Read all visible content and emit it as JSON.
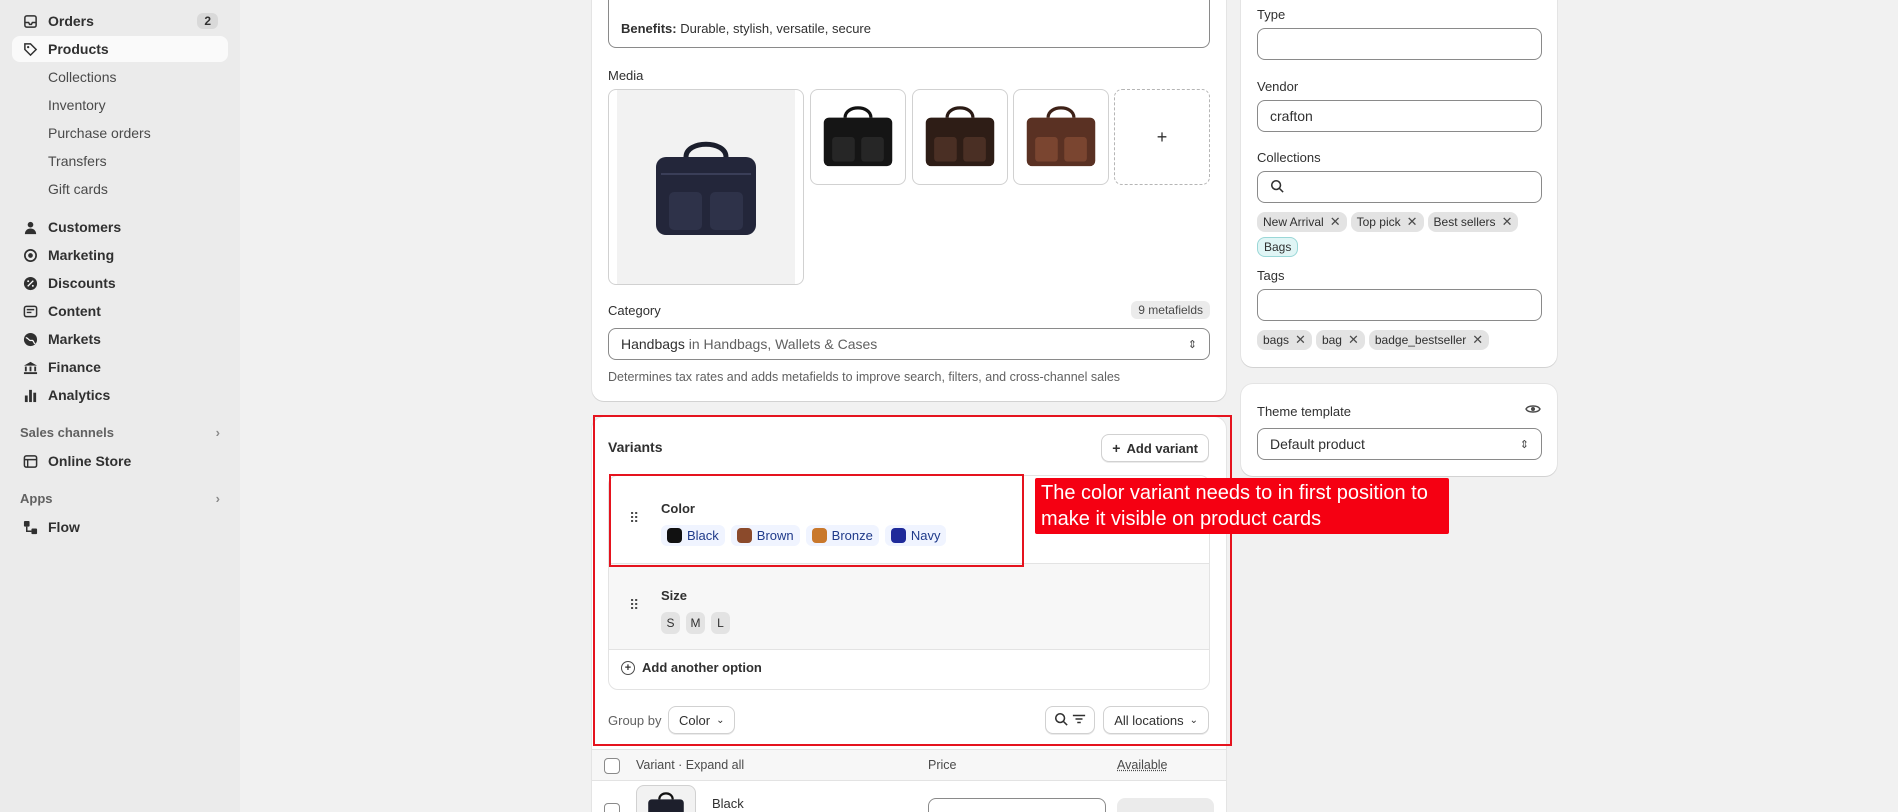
{
  "sidebar": {
    "orders": {
      "label": "Orders",
      "count": "2"
    },
    "products": {
      "label": "Products"
    },
    "products_sub": [
      "Collections",
      "Inventory",
      "Purchase orders",
      "Transfers",
      "Gift cards"
    ],
    "main": [
      "Customers",
      "Marketing",
      "Discounts",
      "Content",
      "Markets",
      "Finance",
      "Analytics"
    ],
    "sales_channels": "Sales channels",
    "online_store": "Online Store",
    "apps": "Apps",
    "flow": "Flow"
  },
  "description": {
    "benefits_label": "Benefits:",
    "benefits_text": "Durable, stylish, versatile, secure"
  },
  "media": {
    "title": "Media",
    "add": "+"
  },
  "category": {
    "title": "Category",
    "metafields": "9 metafields",
    "value_main": "Handbags",
    "value_rest": "in Handbags, Wallets & Cases",
    "help": "Determines tax rates and adds metafields to improve search, filters, and cross-channel sales"
  },
  "variants": {
    "title": "Variants",
    "add_variant": "Add variant",
    "color": {
      "name": "Color",
      "values": [
        {
          "label": "Black",
          "color": "#111111"
        },
        {
          "label": "Brown",
          "color": "#8b4a2b"
        },
        {
          "label": "Bronze",
          "color": "#c9782c"
        },
        {
          "label": "Navy",
          "color": "#1f2a9a"
        }
      ]
    },
    "size": {
      "name": "Size",
      "values": [
        "S",
        "M",
        "L"
      ]
    },
    "add_option": "Add another option",
    "group_by_label": "Group by",
    "group_by_value": "Color",
    "locations": "All locations",
    "table": {
      "col_variant": "Variant",
      "expand_all": "Expand all",
      "col_price": "Price",
      "col_available": "Available",
      "first_row": "Black"
    }
  },
  "callout": "The color variant needs to in first position to make it visible on product cards",
  "org": {
    "type_label": "Type",
    "type_value": "",
    "vendor_label": "Vendor",
    "vendor_value": "crafton",
    "collections_label": "Collections",
    "collections": [
      "New Arrival",
      "Top pick",
      "Best sellers"
    ],
    "collections_extra": "Bags",
    "tags_label": "Tags",
    "tags": [
      "bags",
      "bag",
      "badge_bestseller"
    ]
  },
  "theme": {
    "title": "Theme template",
    "value": "Default product"
  },
  "colors": {
    "accent_red": "#e5131e",
    "callout_bg": "#f50012"
  }
}
